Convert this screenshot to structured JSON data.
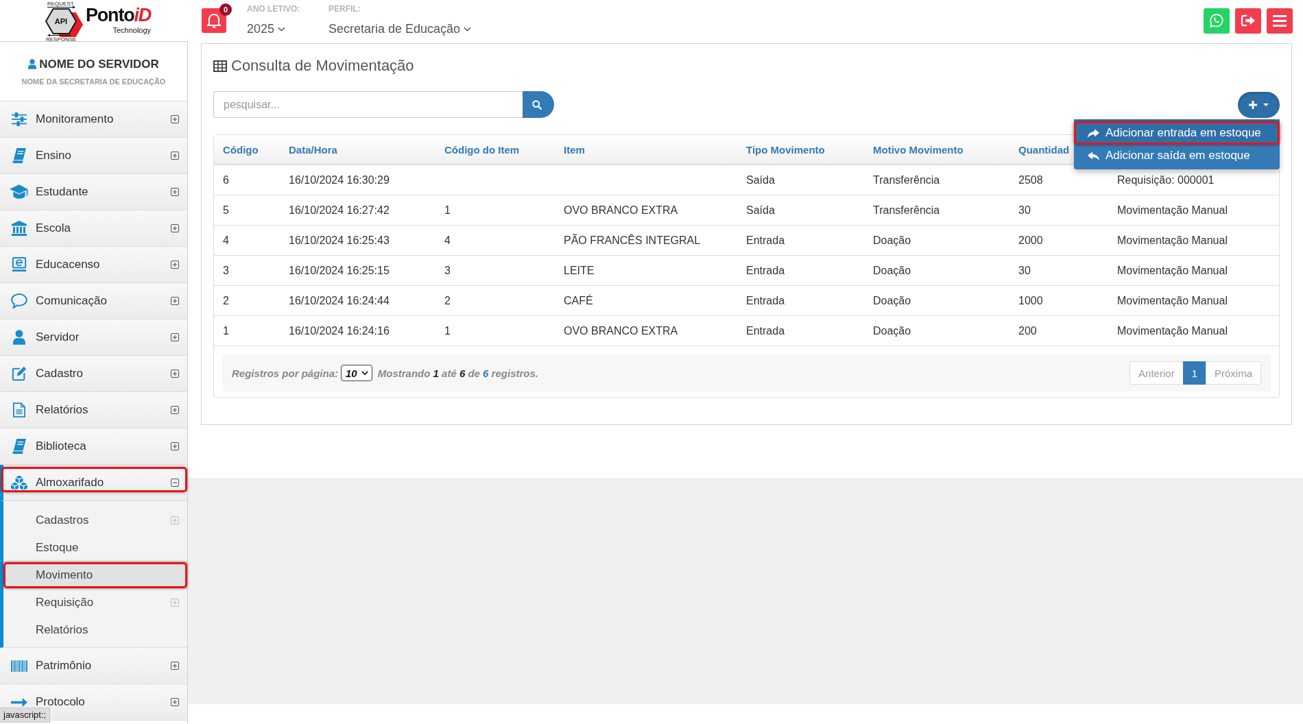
{
  "header": {
    "logo": {
      "badge": "API",
      "top_label": "REQUEST",
      "bottom_label": "RESPONSE",
      "brand": "Ponto",
      "brand_accent": "iD",
      "tagline": "Technology"
    },
    "notifications": {
      "count": "0"
    },
    "school_year": {
      "label": "ANO LETIVO:",
      "value": "2025"
    },
    "profile": {
      "label": "PERFIL:",
      "value": "Secretaria de Educação"
    }
  },
  "sidebar": {
    "user": {
      "name": "NOME DO SERVIDOR",
      "department": "NOME DA SECRETARIA DE EDUCAÇÃO"
    },
    "items": [
      {
        "label": "Monitoramento",
        "expanded": false,
        "highlighted": false
      },
      {
        "label": "Ensino",
        "expanded": false,
        "highlighted": false
      },
      {
        "label": "Estudante",
        "expanded": false,
        "highlighted": false
      },
      {
        "label": "Escola",
        "expanded": false,
        "highlighted": false
      },
      {
        "label": "Educacenso",
        "expanded": false,
        "highlighted": false
      },
      {
        "label": "Comunicação",
        "expanded": false,
        "highlighted": false
      },
      {
        "label": "Servidor",
        "expanded": false,
        "highlighted": false
      },
      {
        "label": "Cadastro",
        "expanded": false,
        "highlighted": false
      },
      {
        "label": "Relatórios",
        "expanded": false,
        "highlighted": false
      },
      {
        "label": "Biblioteca",
        "expanded": false,
        "highlighted": false
      },
      {
        "label": "Almoxarifado",
        "expanded": true,
        "highlighted": true,
        "children": [
          {
            "label": "Cadastros",
            "expandable": true,
            "selected": false,
            "highlighted": false
          },
          {
            "label": "Estoque",
            "expandable": false,
            "selected": false,
            "highlighted": false
          },
          {
            "label": "Movimento",
            "expandable": false,
            "selected": true,
            "highlighted": true
          },
          {
            "label": "Requisição",
            "expandable": true,
            "selected": false,
            "highlighted": false
          },
          {
            "label": "Relatórios",
            "expandable": false,
            "selected": false,
            "highlighted": false
          }
        ]
      },
      {
        "label": "Patrimônio",
        "expanded": false,
        "highlighted": false
      },
      {
        "label": "Protocolo",
        "expanded": false,
        "highlighted": false
      }
    ]
  },
  "panel": {
    "title": "Consulta de Movimentação",
    "search": {
      "placeholder": "pesquisar..."
    },
    "add_menu": {
      "expanded": true,
      "items": [
        {
          "label": "Adicionar entrada em estoque",
          "kind": "entry",
          "highlighted": true
        },
        {
          "label": "Adicionar saída em estoque",
          "kind": "exit",
          "highlighted": false
        }
      ]
    },
    "table": {
      "columns": [
        "Código",
        "Data/Hora",
        "Código do Item",
        "Item",
        "Tipo Movimento",
        "Motivo Movimento",
        "Quantidad"
      ],
      "rows": [
        {
          "code": "6",
          "date_time": "16/10/2024 16:30:29",
          "movement_type": "Saída",
          "movement_reason": "Transferência",
          "quantity": "2508",
          "column_8": "Requisição: 000001"
        },
        {
          "code": "5",
          "date_time": "16/10/2024 16:27:42",
          "item_code": "1",
          "item": "OVO BRANCO EXTRA",
          "movement_type": "Saída",
          "movement_reason": "Transferência",
          "quantity": "30",
          "column_8": "Movimentação Manual"
        },
        {
          "code": "4",
          "date_time": "16/10/2024 16:25:43",
          "item_code": "4",
          "item": "PÃO FRANCÊS INTEGRAL",
          "movement_type": "Entrada",
          "movement_reason": "Doação",
          "quantity": "2000",
          "column_8": "Movimentação Manual"
        },
        {
          "code": "3",
          "date_time": "16/10/2024 16:25:15",
          "item_code": "3",
          "item": "LEITE",
          "movement_type": "Entrada",
          "movement_reason": "Doação",
          "quantity": "30",
          "column_8": "Movimentação Manual"
        },
        {
          "code": "2",
          "date_time": "16/10/2024 16:24:44",
          "item_code": "2",
          "item": "CAFÉ",
          "movement_type": "Entrada",
          "movement_reason": "Doação",
          "quantity": "1000",
          "column_8": "Movimentação Manual"
        },
        {
          "code": "1",
          "date_time": "16/10/2024 16:24:16",
          "item_code": "1",
          "item": "OVO BRANCO EXTRA",
          "movement_type": "Entrada",
          "movement_reason": "Doação",
          "quantity": "200",
          "column_8": "Movimentação Manual"
        }
      ]
    },
    "pagination": {
      "page_size_label": "Registros por página:",
      "page_size": "10",
      "summary": "Mostrando **1** até **6** de **6** registros.",
      "previous": {
        "label": "Anterior",
        "disabled": true
      },
      "pages": [
        {
          "label": "1",
          "selected": true
        }
      ],
      "next": {
        "label": "Próxima",
        "disabled": true
      }
    }
  },
  "status_tooltip": "javascript:;"
}
